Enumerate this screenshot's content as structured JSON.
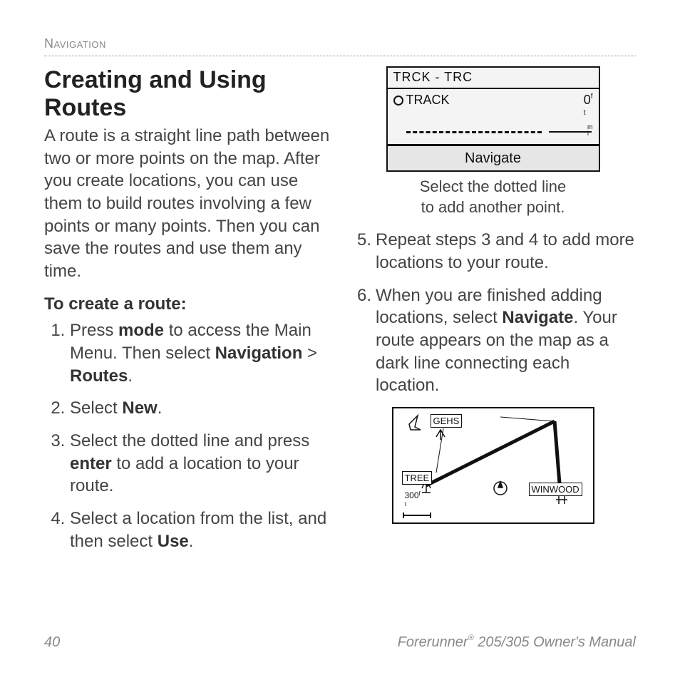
{
  "section_header": "Navigation",
  "title": "Creating and Using Routes",
  "intro": "A route is a straight line path between two or more points on the map. After you create locations, you can use them to build routes involving a few points or many points. Then you can save the routes and use them any time.",
  "subhead": "To create a route:",
  "steps": {
    "s1a": "Press ",
    "s1b": "mode",
    "s1c": " to access the Main Menu. Then select ",
    "s1d": "Navigation",
    "s1e": " > ",
    "s1f": "Routes",
    "s1g": ".",
    "s2a": "Select ",
    "s2b": "New",
    "s2c": ".",
    "s3a": "Select the dotted line and press ",
    "s3b": "enter",
    "s3c": " to add a location to your route.",
    "s4a": "Select a location from the list, and then select ",
    "s4b": "Use",
    "s4c": "."
  },
  "fig1": {
    "title": "TRCK - TRC",
    "track": "TRACK",
    "zero": "0",
    "nav": "Navigate"
  },
  "caption1a": "Select the dotted line",
  "caption1b": "to add another point.",
  "cont": {
    "s5": "Repeat steps 3 and 4 to add more locations to your route.",
    "s6a": "When you are finished adding locations, select ",
    "s6b": "Navigate",
    "s6c": ". Your route appears on the map as a dark line connecting each location."
  },
  "fig2": {
    "gehs": "GEHS",
    "tree": "TREE",
    "winwood": "WINWOOD",
    "scale": "300"
  },
  "footer": {
    "page": "40",
    "product_a": "Forerunner",
    "reg": "®",
    "product_b": " 205/305 Owner's Manual"
  }
}
